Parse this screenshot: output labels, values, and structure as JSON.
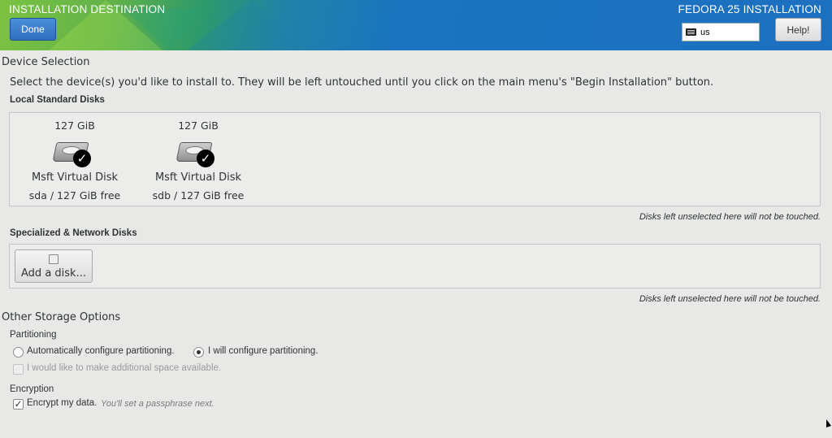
{
  "header": {
    "title": "INSTALLATION DESTINATION",
    "product": "FEDORA 25 INSTALLATION",
    "done_label": "Done",
    "keyboard_layout": "us",
    "help_label": "Help!"
  },
  "device_selection": {
    "heading": "Device Selection",
    "intro": "Select the device(s) you'd like to install to.  They will be left untouched until you click on the main menu's \"Begin Installation\" button.",
    "local_heading": "Local Standard Disks",
    "disks": [
      {
        "size": "127 GiB",
        "name": "Msft Virtual Disk",
        "device": "sda",
        "free": "127 GiB free",
        "selected": true,
        "icon": "hard-disk-icon"
      },
      {
        "size": "127 GiB",
        "name": "Msft Virtual Disk",
        "device": "sdb",
        "free": "127 GiB free",
        "selected": true,
        "icon": "hard-disk-icon"
      }
    ],
    "local_note": "Disks left unselected here will not be touched.",
    "network_heading": "Specialized & Network Disks",
    "add_disk_label": "Add a disk...",
    "network_note": "Disks left unselected here will not be touched."
  },
  "storage_options": {
    "heading": "Other Storage Options",
    "partitioning_heading": "Partitioning",
    "auto_label": "Automatically configure partitioning.",
    "manual_label": "I will configure partitioning.",
    "selected_partitioning": "manual",
    "extra_space_label": "I would like to make additional space available.",
    "encryption_heading": "Encryption",
    "encrypt_label": "Encrypt my data.",
    "encrypt_hint": "You'll set a passphrase next.",
    "encrypt_checked": true
  }
}
